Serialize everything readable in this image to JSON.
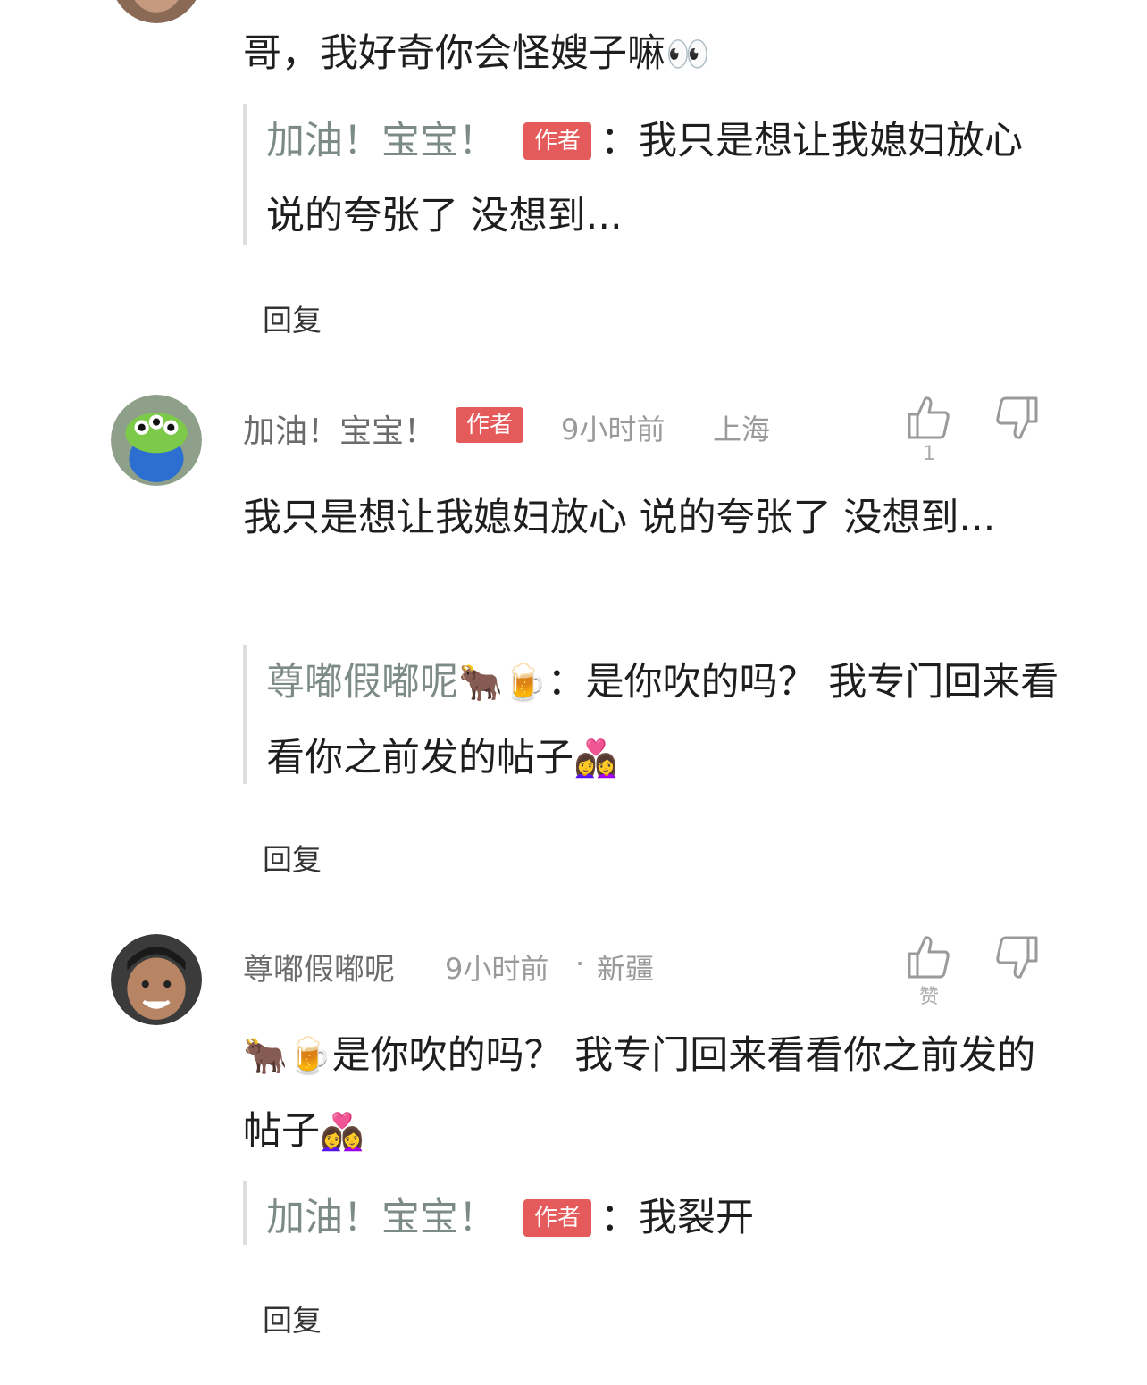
{
  "thread": {
    "top_comment": {
      "text": "哥，我好奇你会怪嫂子嘛",
      "emoji": "👀",
      "quote": {
        "author": "加油！宝宝！",
        "badge": "作者",
        "text": "：我只是想让我媳妇放心 说的夸张了 没想到..."
      },
      "reply_label": "回复"
    },
    "comment_2": {
      "author": "加油！宝宝！",
      "badge": "作者",
      "time": "9小时前",
      "location": "上海",
      "like_count": "1",
      "text": "我只是想让我媳妇放心 说的夸张了 没想到...",
      "quote": {
        "author": "尊嘟假嘟呢",
        "emoji": "🐂🍺",
        "text": "：是你吹的吗？  我专门回来看看你之前发的帖子",
        "emoji_end": "👩‍❤️‍👩"
      },
      "reply_label": "回复"
    },
    "comment_3": {
      "author": "尊嘟假嘟呢",
      "time": "9小时前",
      "location": "新疆",
      "like_label": "赞",
      "emoji": "🐂🍺",
      "text": "是你吹的吗？  我专门回来看看你之前发的帖子",
      "emoji_end": "👩‍❤️‍👩",
      "quote": {
        "author": "加油！宝宝！",
        "badge": "作者",
        "text": "：我裂开"
      },
      "reply_label": "回复"
    }
  },
  "colors": {
    "badge": "#e55a5a",
    "quote_name": "#7d8b86",
    "meta": "#9a9a9a"
  },
  "icons": [
    "thumbs-up-icon",
    "thumbs-down-icon"
  ]
}
